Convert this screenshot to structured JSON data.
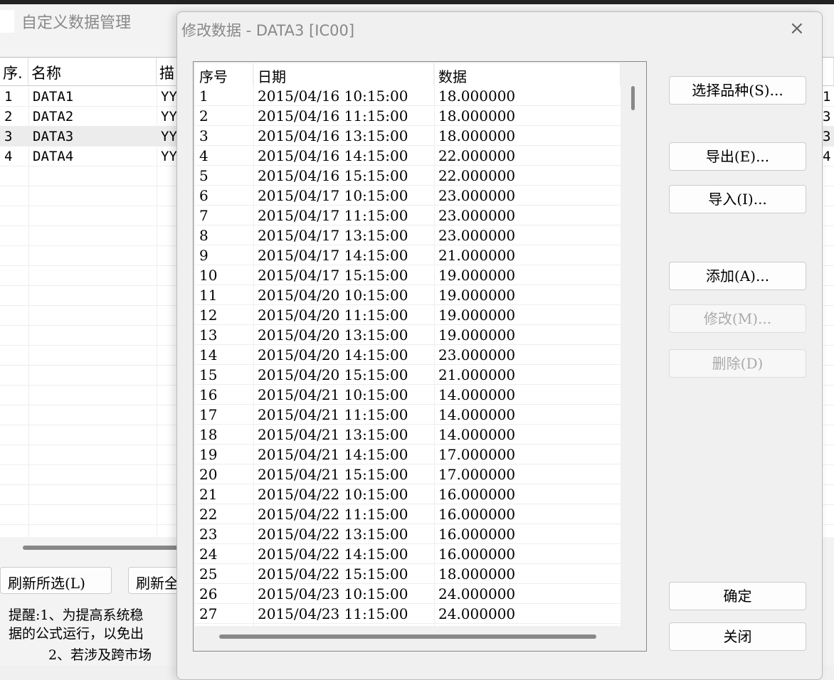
{
  "main_window": {
    "title": "自定义数据管理",
    "columns": [
      "序.",
      "名称",
      "描"
    ],
    "rows": [
      {
        "no": "1",
        "name": "DATA1",
        "desc": "YY",
        "right": "1"
      },
      {
        "no": "2",
        "name": "DATA2",
        "desc": "YY",
        "right": "3"
      },
      {
        "no": "3",
        "name": "DATA3",
        "desc": "YY",
        "right": "3",
        "selected": true
      },
      {
        "no": "4",
        "name": "DATA4",
        "desc": "YY",
        "right": "4"
      }
    ],
    "buttons": {
      "refresh_selected": "刷新所选(L)",
      "refresh_all": "刷新全"
    },
    "notes": [
      "提醒:1、为提高系统稳",
      "据的公式运行，以免出",
      "2、若涉及跨市场"
    ]
  },
  "dialog": {
    "title": "修改数据 - DATA3 [IC00]",
    "columns": [
      "序号",
      "日期",
      "数据"
    ],
    "rows": [
      [
        "1",
        "2015/04/16 10:15:00",
        "18.000000"
      ],
      [
        "2",
        "2015/04/16 11:15:00",
        "18.000000"
      ],
      [
        "3",
        "2015/04/16 13:15:00",
        "18.000000"
      ],
      [
        "4",
        "2015/04/16 14:15:00",
        "22.000000"
      ],
      [
        "5",
        "2015/04/16 15:15:00",
        "22.000000"
      ],
      [
        "6",
        "2015/04/17 10:15:00",
        "23.000000"
      ],
      [
        "7",
        "2015/04/17 11:15:00",
        "23.000000"
      ],
      [
        "8",
        "2015/04/17 13:15:00",
        "23.000000"
      ],
      [
        "9",
        "2015/04/17 14:15:00",
        "21.000000"
      ],
      [
        "10",
        "2015/04/17 15:15:00",
        "19.000000"
      ],
      [
        "11",
        "2015/04/20 10:15:00",
        "19.000000"
      ],
      [
        "12",
        "2015/04/20 11:15:00",
        "19.000000"
      ],
      [
        "13",
        "2015/04/20 13:15:00",
        "19.000000"
      ],
      [
        "14",
        "2015/04/20 14:15:00",
        "23.000000"
      ],
      [
        "15",
        "2015/04/20 15:15:00",
        "21.000000"
      ],
      [
        "16",
        "2015/04/21 10:15:00",
        "14.000000"
      ],
      [
        "17",
        "2015/04/21 11:15:00",
        "14.000000"
      ],
      [
        "18",
        "2015/04/21 13:15:00",
        "14.000000"
      ],
      [
        "19",
        "2015/04/21 14:15:00",
        "17.000000"
      ],
      [
        "20",
        "2015/04/21 15:15:00",
        "17.000000"
      ],
      [
        "21",
        "2015/04/22 10:15:00",
        "16.000000"
      ],
      [
        "22",
        "2015/04/22 11:15:00",
        "16.000000"
      ],
      [
        "23",
        "2015/04/22 13:15:00",
        "16.000000"
      ],
      [
        "24",
        "2015/04/22 14:15:00",
        "16.000000"
      ],
      [
        "25",
        "2015/04/22 15:15:00",
        "18.000000"
      ],
      [
        "26",
        "2015/04/23 10:15:00",
        "24.000000"
      ],
      [
        "27",
        "2015/04/23 11:15:00",
        "24.000000"
      ]
    ],
    "buttons": {
      "select_symbol": "选择品种(S)...",
      "export": "导出(E)...",
      "import": "导入(I)...",
      "add": "添加(A)...",
      "modify": "修改(M)...",
      "delete": "删除(D)",
      "ok": "确定",
      "close": "关闭"
    },
    "close_icon": "×"
  }
}
